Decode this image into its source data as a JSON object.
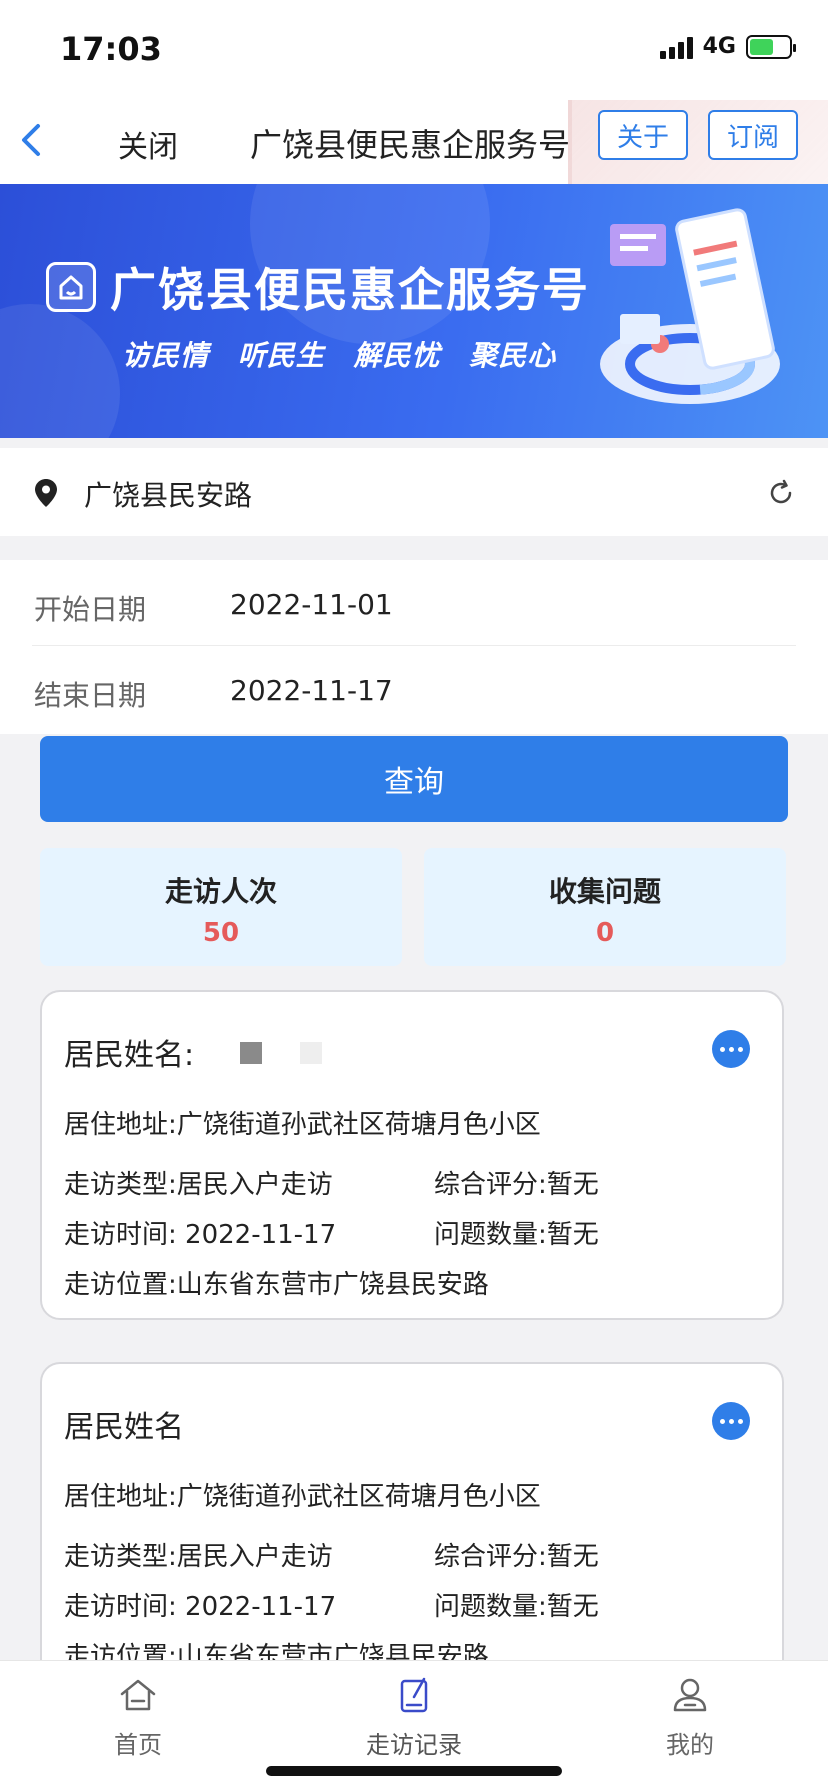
{
  "status_bar": {
    "time": "17:03",
    "network": "4G",
    "icons": [
      "signal-icon",
      "battery-charging-icon"
    ]
  },
  "nav": {
    "back_icon": "chevron-left-icon",
    "close_label": "关闭",
    "title": "广饶县便民惠企服务号",
    "about_label": "关于",
    "subscribe_label": "订阅"
  },
  "banner": {
    "title": "广饶县便民惠企服务号",
    "slogan": "访民情 听民生 解民忧 聚民心",
    "colors": {
      "start": "#2c4fd8",
      "end": "#4d93f5"
    }
  },
  "location": {
    "text": "广饶县民安路",
    "icon": "location-pin-icon",
    "refresh_icon": "refresh-icon"
  },
  "date_filter": {
    "start_label": "开始日期",
    "start_value": "2022-11-01",
    "end_label": "结束日期",
    "end_value": "2022-11-17"
  },
  "query_button": {
    "label": "查询",
    "color": "#2f7ee8"
  },
  "stats": [
    {
      "label": "走访人次",
      "value": "50"
    },
    {
      "label": "收集问题",
      "value": "0"
    }
  ],
  "records": [
    {
      "name_label": "居民姓名:",
      "address": "居住地址:广饶街道孙武社区荷塘月色小区",
      "visit_type": "走访类型:居民入户走访",
      "score": "综合评分:暂无",
      "visit_time": "走访时间: 2022-11-17",
      "issue_count": "问题数量:暂无",
      "visit_location": "走访位置:山东省东营市广饶县民安路"
    },
    {
      "name_label": "居民姓名",
      "address": "居住地址:广饶街道孙武社区荷塘月色小区",
      "visit_type": "走访类型:居民入户走访",
      "score": "综合评分:暂无",
      "visit_time": "走访时间: 2022-11-17",
      "issue_count": "问题数量:暂无",
      "visit_location": "走访位置:山东省东营市广饶县民安路"
    }
  ],
  "tab_bar": {
    "items": [
      {
        "label": "首页",
        "icon": "home-icon"
      },
      {
        "label": "走访记录",
        "icon": "edit-document-icon",
        "active": true
      },
      {
        "label": "我的",
        "icon": "user-icon"
      }
    ]
  },
  "accent_color": "#2f7ee8",
  "stat_value_color": "#e55a5a"
}
